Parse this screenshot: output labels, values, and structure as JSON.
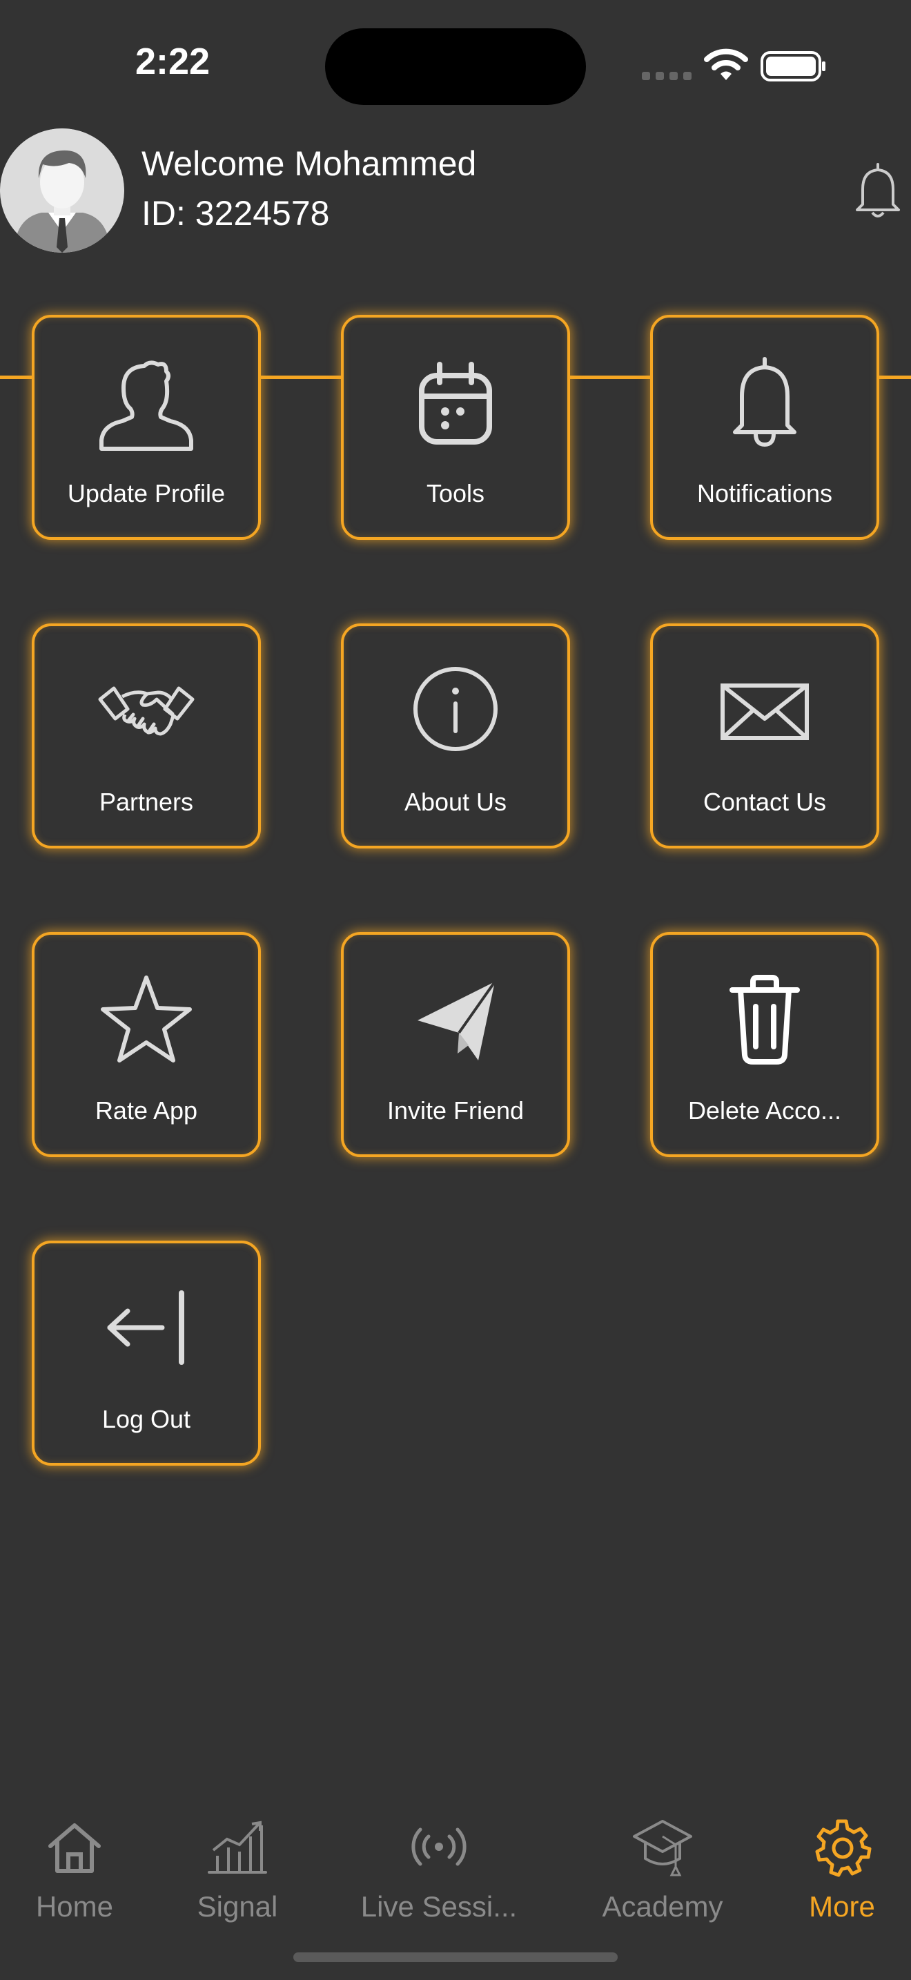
{
  "status_bar": {
    "time": "2:22"
  },
  "header": {
    "welcome": "Welcome Mohammed",
    "user_id": "ID: 3224578",
    "avatar_icon": "user-avatar",
    "bell_icon": "bell-icon"
  },
  "colors": {
    "accent": "#F5A623",
    "background": "#333333",
    "inactive_tab": "#8a8a8a"
  },
  "tiles": [
    {
      "label": "Update Profile",
      "icon": "profile-icon"
    },
    {
      "label": "Tools",
      "icon": "calendar-icon"
    },
    {
      "label": "Notifications",
      "icon": "bell-icon"
    },
    {
      "label": "Partners",
      "icon": "handshake-icon"
    },
    {
      "label": "About Us",
      "icon": "info-icon"
    },
    {
      "label": "Contact Us",
      "icon": "mail-icon"
    },
    {
      "label": "Rate App",
      "icon": "star-icon"
    },
    {
      "label": "Invite Friend",
      "icon": "paper-plane-icon"
    },
    {
      "label": "Delete Acco...",
      "icon": "trash-icon"
    },
    {
      "label": "Log Out",
      "icon": "logout-icon"
    }
  ],
  "tab_bar": {
    "tabs": [
      {
        "label": "Home",
        "icon": "home-icon",
        "active": false
      },
      {
        "label": "Signal",
        "icon": "chart-icon",
        "active": false
      },
      {
        "label": "Live Sessi...",
        "icon": "broadcast-icon",
        "active": false
      },
      {
        "label": "Academy",
        "icon": "graduation-cap-icon",
        "active": false
      },
      {
        "label": "More",
        "icon": "gear-icon",
        "active": true
      }
    ]
  }
}
